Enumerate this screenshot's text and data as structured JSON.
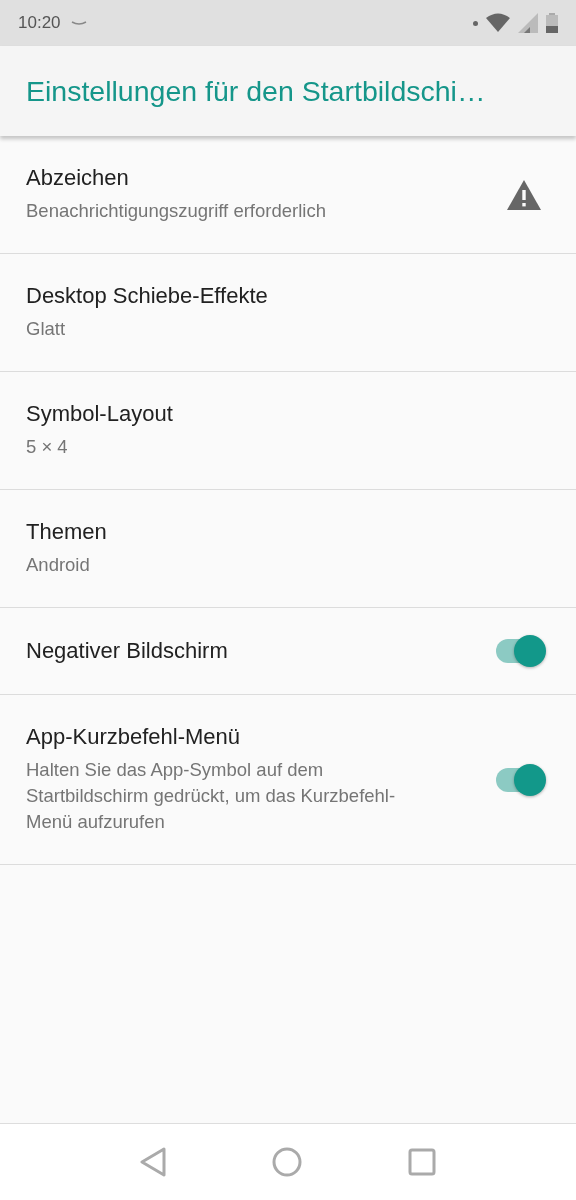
{
  "status_bar": {
    "time": "10:20"
  },
  "app_bar": {
    "title": "Einstellungen für den Startbildschi…"
  },
  "settings": [
    {
      "kind": "warning",
      "title": "Abzeichen",
      "summary": "Benachrichtigungszugriff erforderlich"
    },
    {
      "kind": "plain",
      "title": "Desktop Schiebe-Effekte",
      "summary": "Glatt"
    },
    {
      "kind": "plain",
      "title": "Symbol-Layout",
      "summary": "5 × 4"
    },
    {
      "kind": "plain",
      "title": "Themen",
      "summary": "Android"
    },
    {
      "kind": "toggle",
      "title": "Negativer Bildschirm",
      "on": true
    },
    {
      "kind": "toggle",
      "title": "App-Kurzbefehl-Menü",
      "summary": "Halten Sie das App-Symbol auf dem Startbildschirm gedrückt, um das Kurzbefehl-Menü aufzurufen",
      "on": true
    }
  ]
}
